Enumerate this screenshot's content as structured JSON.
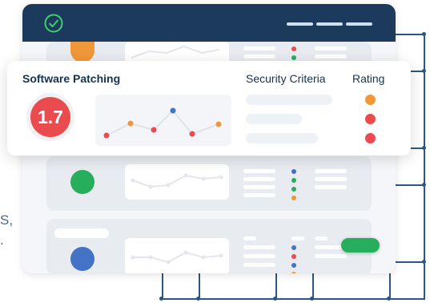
{
  "fragments": {
    "comma": "S,",
    "dot": "."
  },
  "titlebar": {
    "check_icon": "check-circle-icon",
    "menu_icon": "hamburger-icon"
  },
  "score_panel": {
    "title": "Software Patching",
    "criteria_label": "Security Criteria",
    "rating_label": "Rating",
    "score": "1.7",
    "ratings": [
      "#f0973a",
      "#e94b4e",
      "#e94b4e"
    ]
  },
  "colors": {
    "navy": "#1b3a5c",
    "red": "#e94b4e",
    "orange": "#f0973a",
    "green": "#27ae5d",
    "blue": "#4472c4"
  }
}
